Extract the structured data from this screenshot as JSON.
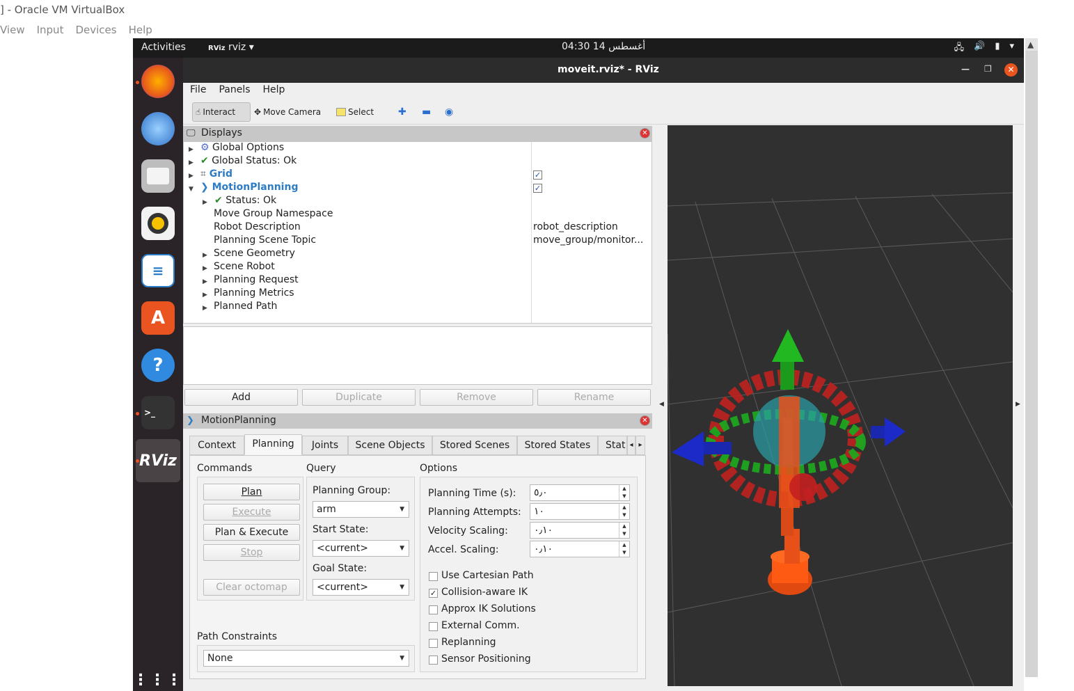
{
  "host": {
    "title": "] - Oracle VM VirtualBox",
    "menu": [
      "View",
      "Input",
      "Devices",
      "Help"
    ]
  },
  "topbar": {
    "activities": "Activities",
    "app_name": "rviz",
    "clock": "04:30  14 أغسطس"
  },
  "window": {
    "title": "moveit.rviz* - RViz"
  },
  "menubar": {
    "file": "File",
    "panels": "Panels",
    "help": "Help"
  },
  "toolbar": {
    "interact": "Interact",
    "move_camera": "Move Camera",
    "select": "Select"
  },
  "displays": {
    "title": "Displays",
    "items": [
      {
        "label": "Global Options"
      },
      {
        "label": "Global Status: Ok"
      },
      {
        "label": "Grid"
      },
      {
        "label": "MotionPlanning"
      },
      {
        "label": "Status: Ok"
      },
      {
        "label": "Move Group Namespace",
        "value": ""
      },
      {
        "label": "Robot Description",
        "value": "robot_description"
      },
      {
        "label": "Planning Scene Topic",
        "value": "move_group/monitor..."
      },
      {
        "label": "Scene Geometry"
      },
      {
        "label": "Scene Robot"
      },
      {
        "label": "Planning Request"
      },
      {
        "label": "Planning Metrics"
      },
      {
        "label": "Planned Path"
      }
    ],
    "grid_checked": true,
    "motion_checked": true
  },
  "display_buttons": {
    "add": "Add",
    "duplicate": "Duplicate",
    "remove": "Remove",
    "rename": "Rename"
  },
  "motion_panel": {
    "title": "MotionPlanning",
    "tabs": [
      "Context",
      "Planning",
      "Joints",
      "Scene Objects",
      "Stored Scenes",
      "Stored States",
      "Stat"
    ],
    "selected_tab": "Planning",
    "commands": {
      "label": "Commands",
      "plan": "Plan",
      "execute": "Execute",
      "plan_execute": "Plan & Execute",
      "stop": "Stop",
      "clear_octomap": "Clear octomap"
    },
    "query": {
      "label": "Query",
      "planning_group_label": "Planning Group:",
      "planning_group": "arm",
      "start_state_label": "Start State:",
      "start_state": "<current>",
      "goal_state_label": "Goal State:",
      "goal_state": "<current>"
    },
    "options": {
      "label": "Options",
      "planning_time_label": "Planning Time (s):",
      "planning_time": "٥٫٠",
      "planning_attempts_label": "Planning Attempts:",
      "planning_attempts": "١٠",
      "velocity_label": "Velocity Scaling:",
      "velocity": "٠٫١٠",
      "accel_label": "Accel. Scaling:",
      "accel": "٠٫١٠",
      "checkboxes": [
        {
          "label": "Use Cartesian Path",
          "checked": false
        },
        {
          "label": "Collision-aware IK",
          "checked": true
        },
        {
          "label": "Approx IK Solutions",
          "checked": false
        },
        {
          "label": "External Comm.",
          "checked": false
        },
        {
          "label": "Replanning",
          "checked": false
        },
        {
          "label": "Sensor Positioning",
          "checked": false
        }
      ]
    },
    "path_constraints": {
      "label": "Path Constraints",
      "value": "None"
    }
  },
  "colors": {
    "accent": "#e95420",
    "link": "#2d7cc4",
    "viewport_bg": "#303030"
  }
}
